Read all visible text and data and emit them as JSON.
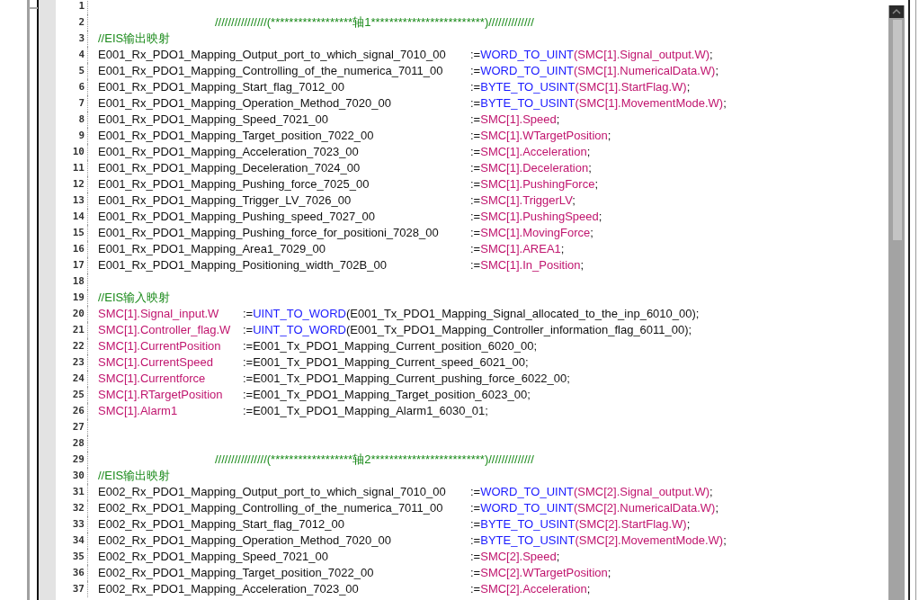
{
  "editor": {
    "lines": [
      {
        "n": "1",
        "kind": "blank"
      },
      {
        "n": "2",
        "kind": "banner",
        "text": "////////////////(******************轴1*************************)//////////////"
      },
      {
        "n": "3",
        "kind": "comment",
        "text": "//EIS输出映射"
      },
      {
        "n": "4",
        "kind": "output",
        "lhs": [
          {
            "text": "E001_Rx_PDO1_Mapping_Output_port_to_which_signal_7010_00",
            "kind": "plain"
          }
        ],
        "rhs": [
          {
            "text": ":=",
            "kind": "plain"
          },
          {
            "text": "WORD_TO_UINT",
            "kind": "fn"
          },
          {
            "text": "(SMC[1].Signal_output.W)",
            "kind": "var"
          },
          {
            "text": ";",
            "kind": "plain"
          }
        ]
      },
      {
        "n": "5",
        "kind": "output",
        "lhs": [
          {
            "text": "E001_Rx_PDO1_Mapping_Controlling_of_the_numerica_7011_00",
            "kind": "plain"
          }
        ],
        "rhs": [
          {
            "text": ":=",
            "kind": "plain"
          },
          {
            "text": "WORD_TO_UINT",
            "kind": "fn"
          },
          {
            "text": "(SMC[1].NumericalData.W)",
            "kind": "var"
          },
          {
            "text": ";",
            "kind": "plain"
          }
        ]
      },
      {
        "n": "6",
        "kind": "output",
        "lhs": [
          {
            "text": "E001_Rx_PDO1_Mapping_Start_flag_7012_00",
            "kind": "plain"
          }
        ],
        "rhs": [
          {
            "text": ":=",
            "kind": "plain"
          },
          {
            "text": "BYTE_TO_USINT",
            "kind": "fn"
          },
          {
            "text": "(SMC[1].StartFlag.W)",
            "kind": "var"
          },
          {
            "text": ";",
            "kind": "plain"
          }
        ]
      },
      {
        "n": "7",
        "kind": "output",
        "lhs": [
          {
            "text": "E001_Rx_PDO1_Mapping_Operation_Method_7020_00",
            "kind": "plain"
          }
        ],
        "rhs": [
          {
            "text": ":=",
            "kind": "plain"
          },
          {
            "text": "BYTE_TO_USINT",
            "kind": "fn"
          },
          {
            "text": "(SMC[1].MovementMode.W)",
            "kind": "var"
          },
          {
            "text": ";",
            "kind": "plain"
          }
        ]
      },
      {
        "n": "8",
        "kind": "output",
        "lhs": [
          {
            "text": "E001_Rx_PDO1_Mapping_Speed_7021_00",
            "kind": "plain"
          }
        ],
        "rhs": [
          {
            "text": ":=",
            "kind": "plain"
          },
          {
            "text": "SMC[1].Speed",
            "kind": "var"
          },
          {
            "text": ";",
            "kind": "plain"
          }
        ]
      },
      {
        "n": "9",
        "kind": "output",
        "lhs": [
          {
            "text": "E001_Rx_PDO1_Mapping_Target_position_7022_00",
            "kind": "plain"
          }
        ],
        "rhs": [
          {
            "text": ":=",
            "kind": "plain"
          },
          {
            "text": "SMC[1].WTargetPosition",
            "kind": "var"
          },
          {
            "text": ";",
            "kind": "plain"
          }
        ]
      },
      {
        "n": "10",
        "kind": "output",
        "lhs": [
          {
            "text": "E001_Rx_PDO1_Mapping_Acceleration_7023_00",
            "kind": "plain"
          }
        ],
        "rhs": [
          {
            "text": ":=",
            "kind": "plain"
          },
          {
            "text": "SMC[1].Acceleration",
            "kind": "var"
          },
          {
            "text": ";",
            "kind": "plain"
          }
        ]
      },
      {
        "n": "11",
        "kind": "output",
        "lhs": [
          {
            "text": "E001_Rx_PDO1_Mapping_Deceleration_7024_00",
            "kind": "plain"
          }
        ],
        "rhs": [
          {
            "text": ":=",
            "kind": "plain"
          },
          {
            "text": "SMC[1].Deceleration",
            "kind": "var"
          },
          {
            "text": ";",
            "kind": "plain"
          }
        ]
      },
      {
        "n": "12",
        "kind": "output",
        "lhs": [
          {
            "text": "E001_Rx_PDO1_Mapping_Pushing_force_7025_00",
            "kind": "plain"
          }
        ],
        "rhs": [
          {
            "text": ":=",
            "kind": "plain"
          },
          {
            "text": "SMC[1].PushingForce",
            "kind": "var"
          },
          {
            "text": ";",
            "kind": "plain"
          }
        ]
      },
      {
        "n": "13",
        "kind": "output",
        "lhs": [
          {
            "text": "E001_Rx_PDO1_Mapping_Trigger_LV_7026_00",
            "kind": "plain"
          }
        ],
        "rhs": [
          {
            "text": ":=",
            "kind": "plain"
          },
          {
            "text": "SMC[1].TriggerLV",
            "kind": "var"
          },
          {
            "text": ";",
            "kind": "plain"
          }
        ]
      },
      {
        "n": "14",
        "kind": "output",
        "lhs": [
          {
            "text": "E001_Rx_PDO1_Mapping_Pushing_speed_7027_00",
            "kind": "plain"
          }
        ],
        "rhs": [
          {
            "text": ":=",
            "kind": "plain"
          },
          {
            "text": "SMC[1].PushingSpeed",
            "kind": "var"
          },
          {
            "text": ";",
            "kind": "plain"
          }
        ]
      },
      {
        "n": "15",
        "kind": "output",
        "lhs": [
          {
            "text": "E001_Rx_PDO1_Mapping_Pushing_force_for_positioni_7028_00",
            "kind": "plain"
          }
        ],
        "rhs": [
          {
            "text": ":=",
            "kind": "plain"
          },
          {
            "text": "SMC[1].MovingForce",
            "kind": "var"
          },
          {
            "text": ";",
            "kind": "plain"
          }
        ]
      },
      {
        "n": "16",
        "kind": "output",
        "lhs": [
          {
            "text": "E001_Rx_PDO1_Mapping_Area1_7029_00",
            "kind": "plain"
          }
        ],
        "rhs": [
          {
            "text": ":=",
            "kind": "plain"
          },
          {
            "text": "SMC[1].AREA1",
            "kind": "var"
          },
          {
            "text": ";",
            "kind": "plain"
          }
        ]
      },
      {
        "n": "17",
        "kind": "output",
        "lhs": [
          {
            "text": "E001_Rx_PDO1_Mapping_Positioning_width_702B_00",
            "kind": "plain"
          }
        ],
        "rhs": [
          {
            "text": ":=",
            "kind": "plain"
          },
          {
            "text": "SMC[1].In_Position",
            "kind": "var"
          },
          {
            "text": ";",
            "kind": "plain"
          }
        ]
      },
      {
        "n": "18",
        "kind": "blank"
      },
      {
        "n": "19",
        "kind": "comment",
        "text": "//EIS输入映射"
      },
      {
        "n": "20",
        "kind": "input",
        "lhs": [
          {
            "text": "SMC[1].Signal_input.W",
            "kind": "var"
          }
        ],
        "rhs": [
          {
            "text": ":=",
            "kind": "plain"
          },
          {
            "text": "UINT_TO_WORD",
            "kind": "fn"
          },
          {
            "text": "(E001_Tx_PDO1_Mapping_Signal_allocated_to_the_inp_6010_00);",
            "kind": "plain"
          }
        ]
      },
      {
        "n": "21",
        "kind": "input",
        "lhs": [
          {
            "text": "SMC[1].Controller_flag.W",
            "kind": "var"
          }
        ],
        "rhs": [
          {
            "text": ":=",
            "kind": "plain"
          },
          {
            "text": "UINT_TO_WORD",
            "kind": "fn"
          },
          {
            "text": "(E001_Tx_PDO1_Mapping_Controller_information_flag_6011_00);",
            "kind": "plain"
          }
        ]
      },
      {
        "n": "22",
        "kind": "input",
        "lhs": [
          {
            "text": "SMC[1].CurrentPosition",
            "kind": "var"
          }
        ],
        "rhs": [
          {
            "text": ":=E001_Tx_PDO1_Mapping_Current_position_6020_00;",
            "kind": "plain"
          }
        ]
      },
      {
        "n": "23",
        "kind": "input",
        "lhs": [
          {
            "text": "SMC[1].CurrentSpeed",
            "kind": "var"
          }
        ],
        "rhs": [
          {
            "text": ":=E001_Tx_PDO1_Mapping_Current_speed_6021_00;",
            "kind": "plain"
          }
        ]
      },
      {
        "n": "24",
        "kind": "input",
        "lhs": [
          {
            "text": "SMC[1].Currentforce",
            "kind": "var"
          }
        ],
        "rhs": [
          {
            "text": ":=E001_Tx_PDO1_Mapping_Current_pushing_force_6022_00;",
            "kind": "plain"
          }
        ]
      },
      {
        "n": "25",
        "kind": "input",
        "lhs": [
          {
            "text": "SMC[1].RTargetPosition",
            "kind": "var"
          }
        ],
        "rhs": [
          {
            "text": ":=E001_Tx_PDO1_Mapping_Target_position_6023_00;",
            "kind": "plain"
          }
        ]
      },
      {
        "n": "26",
        "kind": "input",
        "lhs": [
          {
            "text": "SMC[1].Alarm1",
            "kind": "var"
          }
        ],
        "rhs": [
          {
            "text": ":=E001_Tx_PDO1_Mapping_Alarm1_6030_01;",
            "kind": "plain"
          }
        ]
      },
      {
        "n": "27",
        "kind": "blank"
      },
      {
        "n": "28",
        "kind": "blank"
      },
      {
        "n": "29",
        "kind": "banner",
        "text": "////////////////(******************轴2*************************)//////////////"
      },
      {
        "n": "30",
        "kind": "comment",
        "text": "//EIS输出映射"
      },
      {
        "n": "31",
        "kind": "output",
        "lhs": [
          {
            "text": "E002_Rx_PDO1_Mapping_Output_port_to_which_signal_7010_00",
            "kind": "plain"
          }
        ],
        "rhs": [
          {
            "text": ":=",
            "kind": "plain"
          },
          {
            "text": "WORD_TO_UINT",
            "kind": "fn"
          },
          {
            "text": "(SMC[2].Signal_output.W)",
            "kind": "var"
          },
          {
            "text": ";",
            "kind": "plain"
          }
        ]
      },
      {
        "n": "32",
        "kind": "output",
        "lhs": [
          {
            "text": "E002_Rx_PDO1_Mapping_Controlling_of_the_numerica_7011_00",
            "kind": "plain"
          }
        ],
        "rhs": [
          {
            "text": ":=",
            "kind": "plain"
          },
          {
            "text": "WORD_TO_UINT",
            "kind": "fn"
          },
          {
            "text": "(SMC[2].NumericalData.W)",
            "kind": "var"
          },
          {
            "text": ";",
            "kind": "plain"
          }
        ]
      },
      {
        "n": "33",
        "kind": "output",
        "lhs": [
          {
            "text": "E002_Rx_PDO1_Mapping_Start_flag_7012_00",
            "kind": "plain"
          }
        ],
        "rhs": [
          {
            "text": ":=",
            "kind": "plain"
          },
          {
            "text": "BYTE_TO_USINT",
            "kind": "fn"
          },
          {
            "text": "(SMC[2].StartFlag.W)",
            "kind": "var"
          },
          {
            "text": ";",
            "kind": "plain"
          }
        ]
      },
      {
        "n": "34",
        "kind": "output",
        "lhs": [
          {
            "text": "E002_Rx_PDO1_Mapping_Operation_Method_7020_00",
            "kind": "plain"
          }
        ],
        "rhs": [
          {
            "text": ":=",
            "kind": "plain"
          },
          {
            "text": "BYTE_TO_USINT",
            "kind": "fn"
          },
          {
            "text": "(SMC[2].MovementMode.W)",
            "kind": "var"
          },
          {
            "text": ";",
            "kind": "plain"
          }
        ]
      },
      {
        "n": "35",
        "kind": "output",
        "lhs": [
          {
            "text": "E002_Rx_PDO1_Mapping_Speed_7021_00",
            "kind": "plain"
          }
        ],
        "rhs": [
          {
            "text": ":=",
            "kind": "plain"
          },
          {
            "text": "SMC[2].Speed",
            "kind": "var"
          },
          {
            "text": ";",
            "kind": "plain"
          }
        ]
      },
      {
        "n": "36",
        "kind": "output",
        "lhs": [
          {
            "text": "E002_Rx_PDO1_Mapping_Target_position_7022_00",
            "kind": "plain"
          }
        ],
        "rhs": [
          {
            "text": ":=",
            "kind": "plain"
          },
          {
            "text": "SMC[2].WTargetPosition",
            "kind": "var"
          },
          {
            "text": ";",
            "kind": "plain"
          }
        ]
      },
      {
        "n": "37",
        "kind": "output",
        "lhs": [
          {
            "text": "E002_Rx_PDO1_Mapping_Acceleration_7023_00",
            "kind": "plain"
          }
        ],
        "rhs": [
          {
            "text": ":=",
            "kind": "plain"
          },
          {
            "text": "SMC[2].Acceleration",
            "kind": "var"
          },
          {
            "text": ";",
            "kind": "plain"
          }
        ]
      }
    ]
  }
}
